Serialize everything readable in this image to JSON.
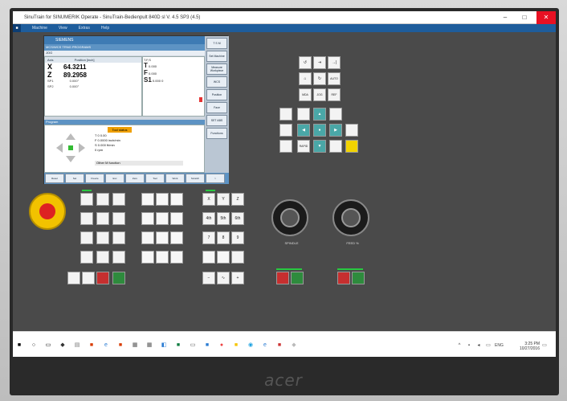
{
  "window": {
    "title": "SinuTrain for SINUMERIK Operate - SinuTrain-Bedienpult 840D sl V. 4.5 SP3 (4.5)",
    "min": "–",
    "max": "□",
    "close": "✕"
  },
  "menu": {
    "home_icon": "windows-icon",
    "items": [
      "Machine",
      "View",
      "Extras",
      "Help"
    ]
  },
  "cnc": {
    "brand": "SIEMENS",
    "header": "MCS/WCS TRNG PROGRAMS",
    "mode": "JOG",
    "col_axis": "Axis",
    "col_pos": "Position [inch]",
    "axes": [
      {
        "name": "X",
        "value": "64.3211"
      },
      {
        "name": "Z",
        "value": "89.2958"
      }
    ],
    "small_rows": [
      {
        "name": "SP1",
        "value": "0.000°"
      },
      {
        "name": "SP2",
        "value": "0.000°"
      }
    ],
    "feed_title": "T,F,S",
    "feed_tool": "T",
    "feed_f": "F",
    "feed_s": "S1",
    "feed_vals": [
      "0.000",
      "0.000",
      "0.000",
      "0"
    ],
    "program_bar": "Program",
    "jog_orange": "Tool status",
    "jog_lines": [
      "T  0   0.00",
      "F  0.0000 inch/min",
      "S  0.000  ft/min",
      "0  rpm"
    ],
    "jog_bar": "Other M function",
    "side": [
      "T S M",
      "Set Machine",
      "Measure Workpiece",
      "WCS",
      "Position",
      "Face",
      "SET ABS",
      "Functions"
    ],
    "bottom": [
      "Reset",
      "Set",
      "Freeze",
      "Exc",
      "Zero",
      "Tool",
      "Work",
      "Scratch",
      ">"
    ]
  },
  "keys": {
    "left_group": [
      "",
      "",
      "",
      "",
      "",
      "",
      "",
      "",
      "",
      "",
      "",
      "",
      "",
      "",
      "",
      "",
      "",
      ""
    ],
    "right_group": [
      "X",
      "Y",
      "Z",
      "4th",
      "5th",
      "6th",
      "7",
      "8",
      "9",
      "−",
      "∿",
      "+"
    ],
    "upper": [
      "↺",
      "⇥",
      "→|",
      "⌂",
      "↻",
      "AUTO",
      "MDA",
      "JOG",
      "REF"
    ],
    "mid_arrows": [
      "▲",
      "◀",
      "●",
      "▶",
      "▼"
    ],
    "rapid": "RAPID",
    "reset": "RESET",
    "red_labels": [
      "CYCLE STOP",
      "SPINDLE STOP",
      "FEED STOP"
    ],
    "green_labels": [
      "CYCLE START",
      "SPINDLE START",
      "FEED START"
    ]
  },
  "dials": [
    {
      "label": "SPINDLE"
    },
    {
      "label": "FEED %"
    }
  ],
  "taskbar": {
    "time": "3:25 PM",
    "date": "10/27/2016",
    "lang": "ENG"
  },
  "monitor_brand": "acer"
}
